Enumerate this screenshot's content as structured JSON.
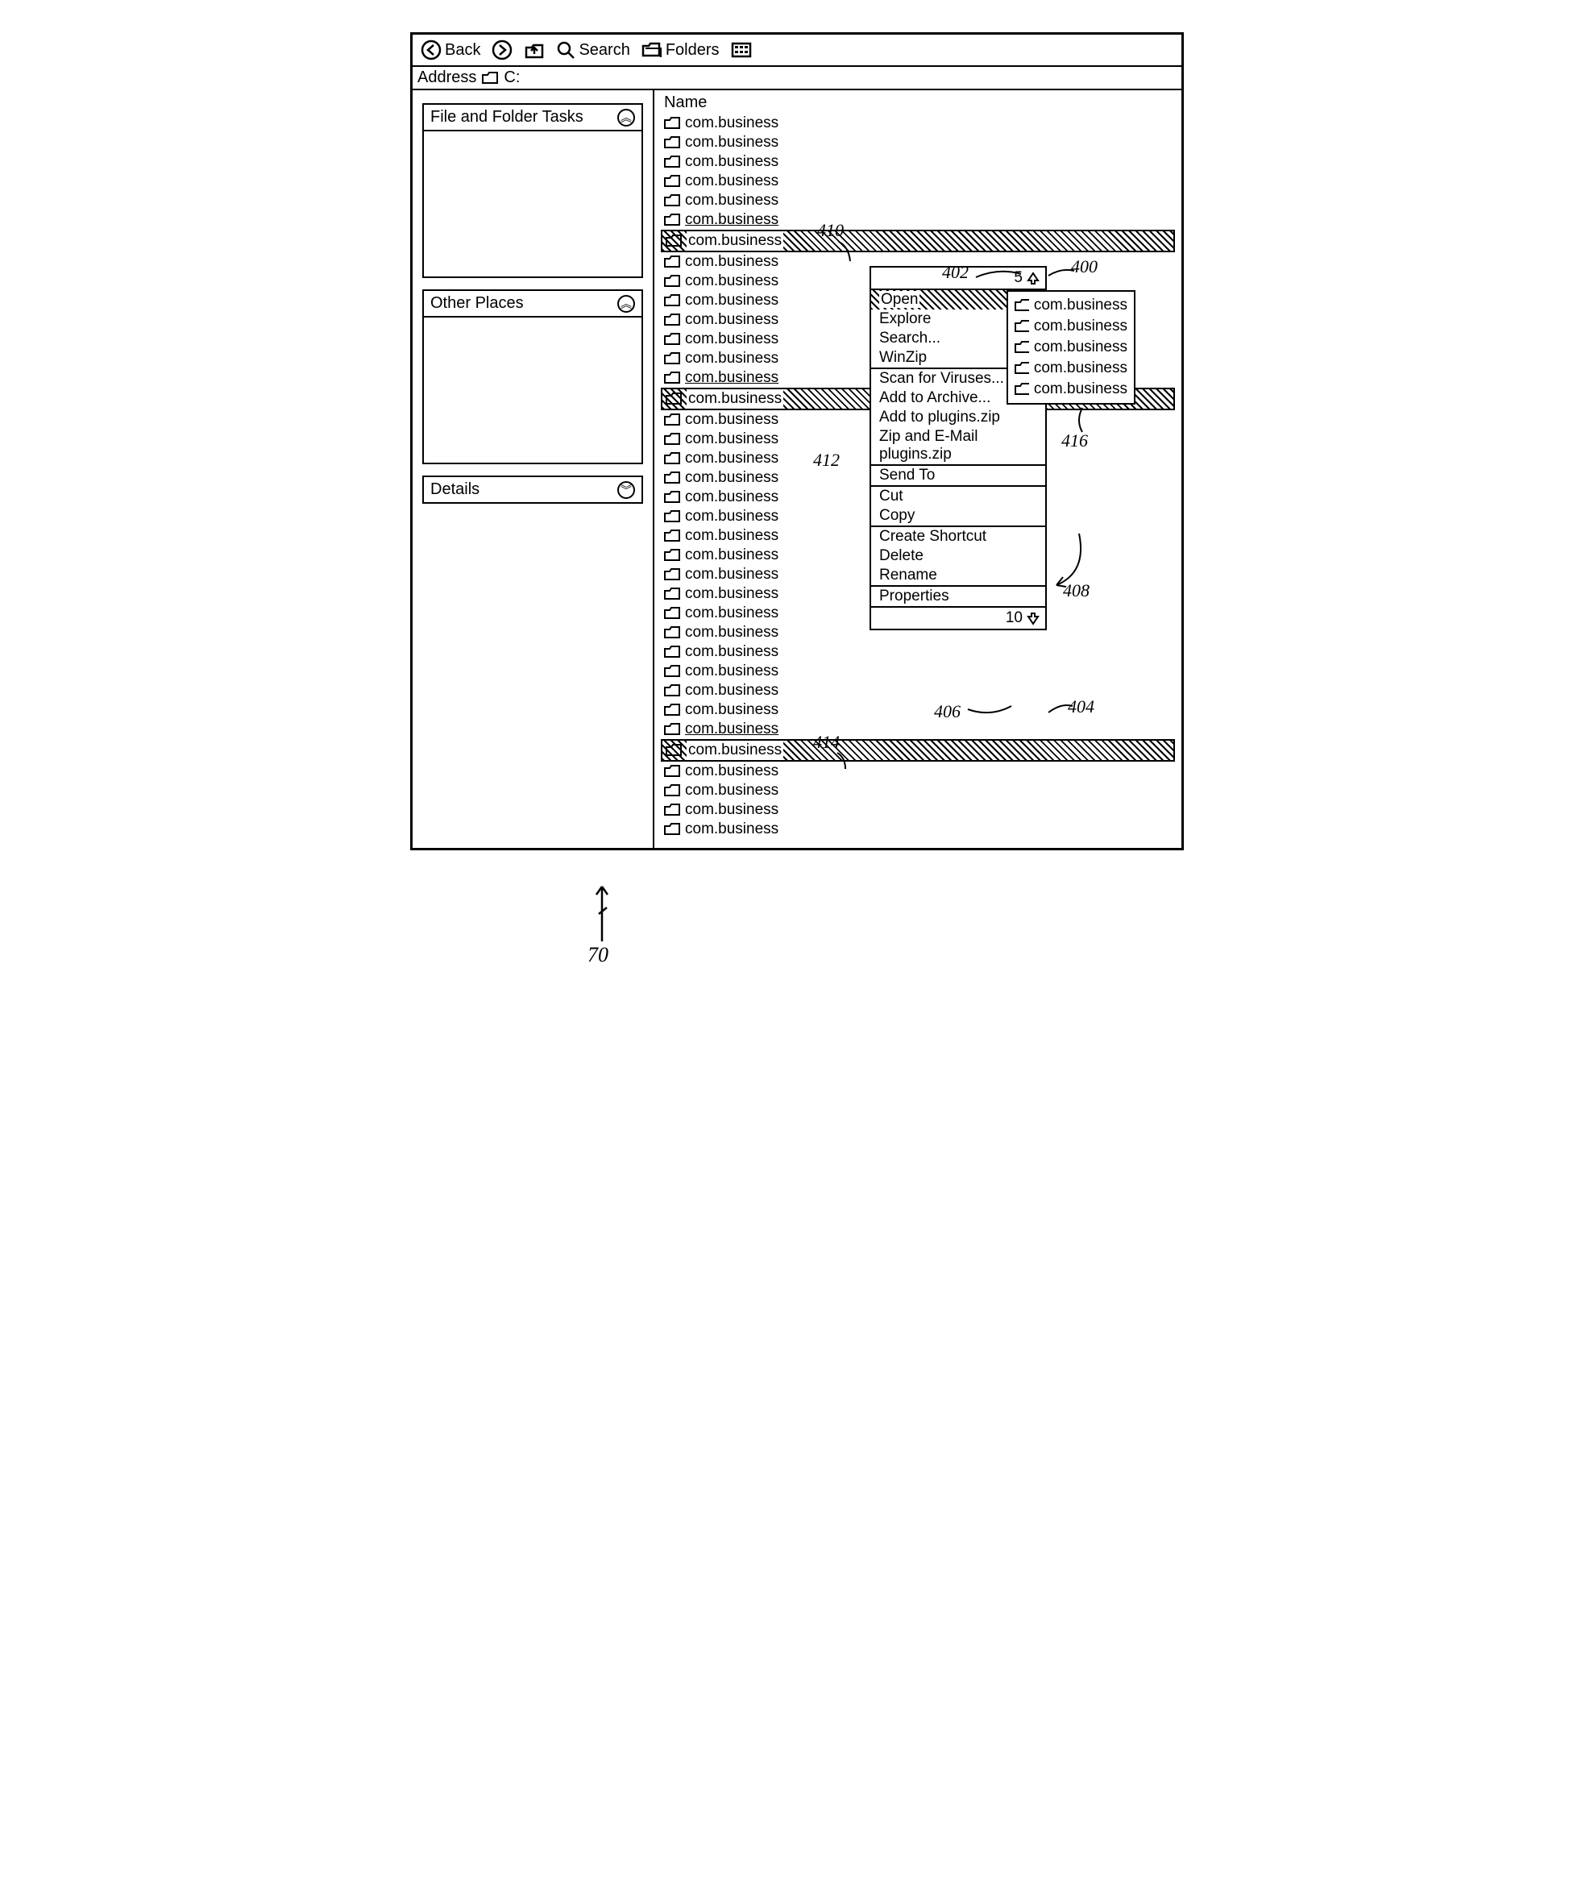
{
  "toolbar": {
    "back_label": "Back",
    "search_label": "Search",
    "folders_label": "Folders"
  },
  "addressbar": {
    "label": "Address",
    "path": "C:"
  },
  "sidebar": {
    "panels": [
      {
        "title": "File and Folder Tasks",
        "chev": "up",
        "body": "tall"
      },
      {
        "title": "Other Places",
        "chev": "up",
        "body": "tall"
      },
      {
        "title": "Details",
        "chev": "down",
        "body": "zero"
      }
    ]
  },
  "content": {
    "column_header": "Name",
    "folder_label": "com.business",
    "folder_count": 37,
    "selected_indices": [
      6,
      14,
      32
    ],
    "underlined_before_selected": [
      5,
      13,
      31
    ]
  },
  "context_menu": {
    "pager_top_value": "5",
    "pager_bottom_value": "10",
    "groups": [
      [
        "Open",
        "Explore",
        "Search...",
        "WinZip"
      ],
      [
        "Scan for Viruses...",
        "Add to Archive...",
        "Add to plugins.zip",
        "Zip and E-Mail plugins.zip"
      ],
      [
        "Send To"
      ],
      [
        "Cut",
        "Copy"
      ],
      [
        "Create Shortcut",
        "Delete",
        "Rename"
      ],
      [
        "Properties"
      ]
    ],
    "highlighted_item": "Open"
  },
  "submenu": {
    "folder_label": "com.business",
    "count": 5
  },
  "annotations": {
    "a400": "400",
    "a402": "402",
    "a404": "404",
    "a406": "406",
    "a408": "408",
    "a410": "410",
    "a412": "412",
    "a414": "414",
    "a416": "416",
    "a70": "70"
  }
}
